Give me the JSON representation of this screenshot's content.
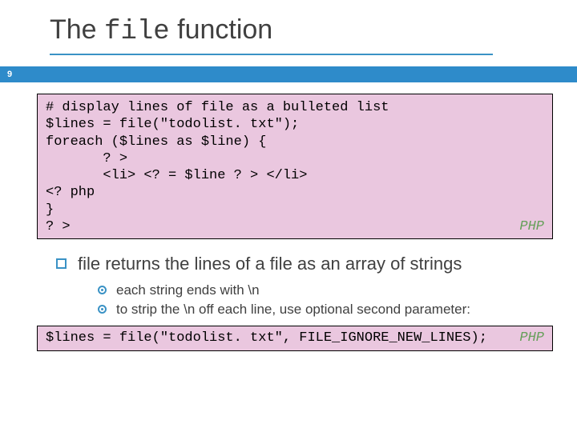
{
  "title": {
    "pre": "The ",
    "mono": "file",
    "post": " function"
  },
  "slide_number": "9",
  "code1": {
    "lines": [
      "# display lines of file as a bulleted list",
      "$lines = file(\"todolist. txt\");",
      "foreach ($lines as $line) {",
      "       ? >",
      "       <li> <? = $line ? > </li>",
      "<? php",
      "}",
      "? >"
    ],
    "lang_label": "PHP"
  },
  "bullet_main": "file returns the lines of a file as an array of strings",
  "sub_bullets": [
    "each string ends with \\n",
    "to strip the \\n off each line, use optional second parameter:"
  ],
  "code2": {
    "line": "$lines = file(\"todolist. txt\", FILE_IGNORE_NEW_LINES);",
    "lang_label": "PHP"
  }
}
